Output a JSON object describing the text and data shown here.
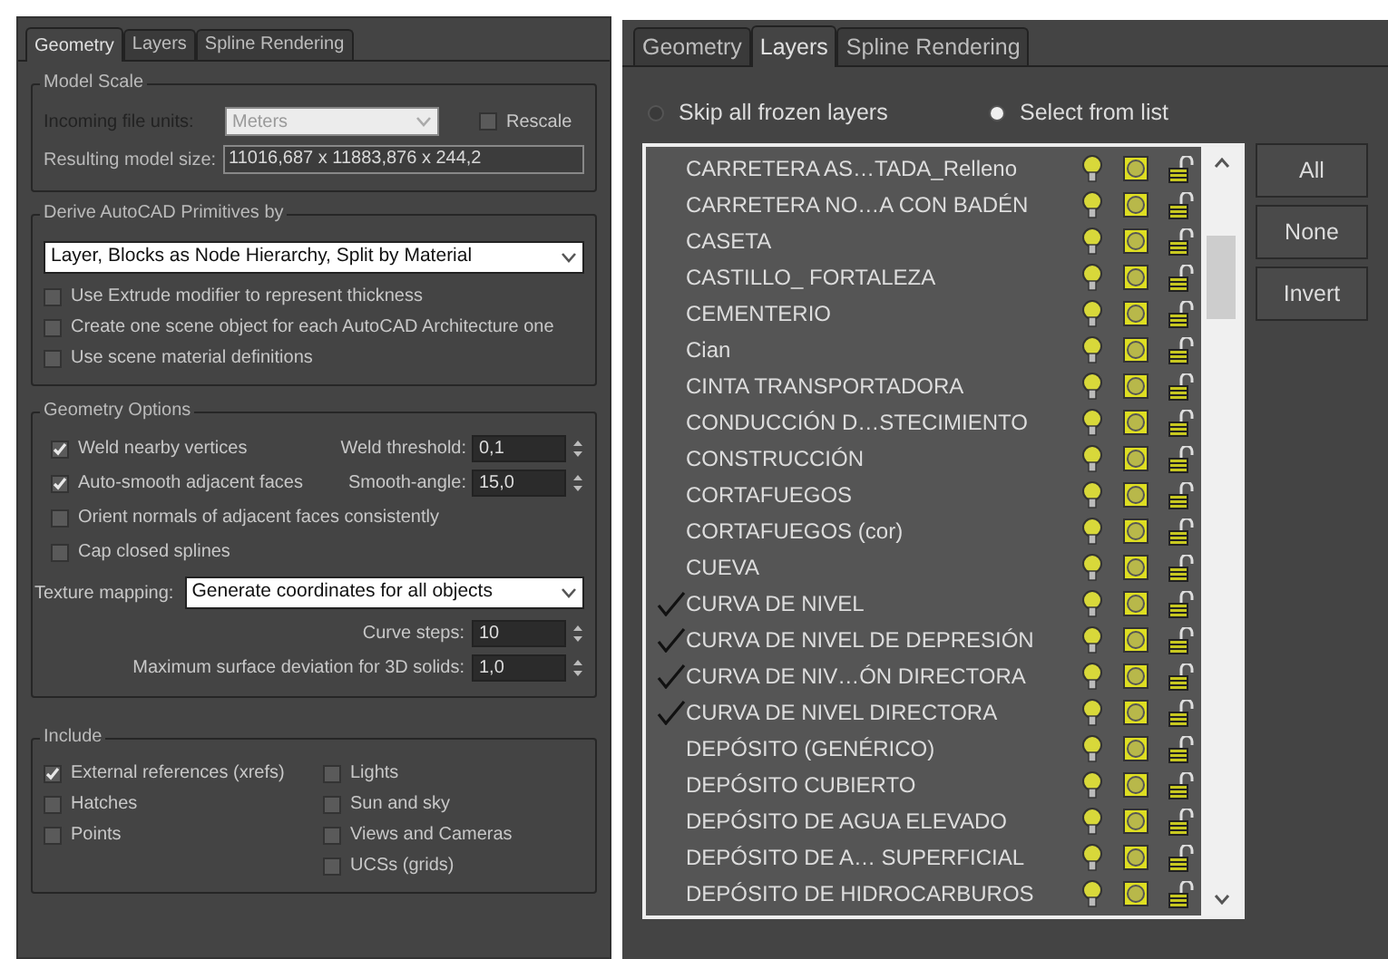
{
  "left_panel": {
    "tabs": [
      {
        "label": "Geometry",
        "selected": true
      },
      {
        "label": "Layers",
        "selected": false
      },
      {
        "label": "Spline Rendering",
        "selected": false
      }
    ],
    "model_scale": {
      "title": "Model Scale",
      "units_label": "Incoming file units:",
      "units_value": "Meters",
      "rescale": {
        "label": "Rescale",
        "checked": false
      },
      "size_label": "Resulting model size:",
      "size_value": "11016,687 x 11883,876 x 244,2"
    },
    "derive": {
      "title": "Derive AutoCAD Primitives by",
      "dropdown": "Layer, Blocks as Node Hierarchy, Split by Material",
      "options": [
        {
          "label": "Use Extrude modifier to represent thickness",
          "checked": false
        },
        {
          "label": "Create one scene object for each AutoCAD Architecture one",
          "checked": false
        },
        {
          "label": "Use scene material definitions",
          "checked": false
        }
      ]
    },
    "geometry_options": {
      "title": "Geometry Options",
      "options": [
        {
          "label": "Weld nearby vertices",
          "checked": true,
          "field_label": "Weld threshold:",
          "field_value": "0,1"
        },
        {
          "label": "Auto-smooth adjacent faces",
          "checked": true,
          "field_label": "Smooth-angle:",
          "field_value": "15,0"
        },
        {
          "label": "Orient normals of adjacent faces consistently",
          "checked": false
        },
        {
          "label": "Cap closed splines",
          "checked": false
        }
      ],
      "texture_label": "Texture mapping:",
      "texture_value": "Generate coordinates for all objects",
      "spinners": [
        {
          "label": "Curve steps:",
          "value": "10"
        },
        {
          "label": "Maximum surface deviation for 3D solids:",
          "value": "1,0"
        }
      ]
    },
    "include": {
      "title": "Include",
      "column_1": [
        {
          "label": "External references (xrefs)",
          "checked": true
        },
        {
          "label": "Hatches",
          "checked": false
        },
        {
          "label": "Points",
          "checked": false
        }
      ],
      "column_2": [
        {
          "label": "Lights",
          "checked": false
        },
        {
          "label": "Sun and sky",
          "checked": false
        },
        {
          "label": "Views and Cameras",
          "checked": false
        },
        {
          "label": "UCSs (grids)",
          "checked": false
        }
      ]
    }
  },
  "right_panel": {
    "tabs": [
      {
        "label": "Geometry",
        "selected": false
      },
      {
        "label": "Layers",
        "selected": true
      },
      {
        "label": "Spline Rendering",
        "selected": false
      }
    ],
    "radios": [
      {
        "label": "Skip all frozen layers",
        "selected": false
      },
      {
        "label": "Select from list",
        "selected": true
      }
    ],
    "layers": [
      {
        "name": "CARRETERA AS…TADA_Relleno",
        "checked": false
      },
      {
        "name": "CARRETERA NO…A CON BADÉN",
        "checked": false
      },
      {
        "name": "CASETA",
        "checked": false
      },
      {
        "name": "CASTILLO_ FORTALEZA",
        "checked": false
      },
      {
        "name": "CEMENTERIO",
        "checked": false
      },
      {
        "name": "Cian",
        "checked": false
      },
      {
        "name": "CINTA TRANSPORTADORA",
        "checked": false
      },
      {
        "name": "CONDUCCIÓN D…STECIMIENTO",
        "checked": false
      },
      {
        "name": "CONSTRUCCIÓN",
        "checked": false
      },
      {
        "name": "CORTAFUEGOS",
        "checked": false
      },
      {
        "name": "CORTAFUEGOS (cor)",
        "checked": false
      },
      {
        "name": "CUEVA",
        "checked": false
      },
      {
        "name": "CURVA DE NIVEL",
        "checked": true
      },
      {
        "name": "CURVA DE NIVEL DE DEPRESIÓN",
        "checked": true
      },
      {
        "name": "CURVA DE NIV…ÓN DIRECTORA",
        "checked": true
      },
      {
        "name": "CURVA DE NIVEL DIRECTORA",
        "checked": true
      },
      {
        "name": "DEPÓSITO (GENÉRICO)",
        "checked": false
      },
      {
        "name": "DEPÓSITO CUBIERTO",
        "checked": false
      },
      {
        "name": "DEPÓSITO DE AGUA ELEVADO",
        "checked": false
      },
      {
        "name": "DEPÓSITO DE A… SUPERFICIAL",
        "checked": false
      },
      {
        "name": "DEPÓSITO DE HIDROCARBUROS",
        "checked": false
      }
    ],
    "buttons": [
      "All",
      "None",
      "Invert"
    ]
  }
}
